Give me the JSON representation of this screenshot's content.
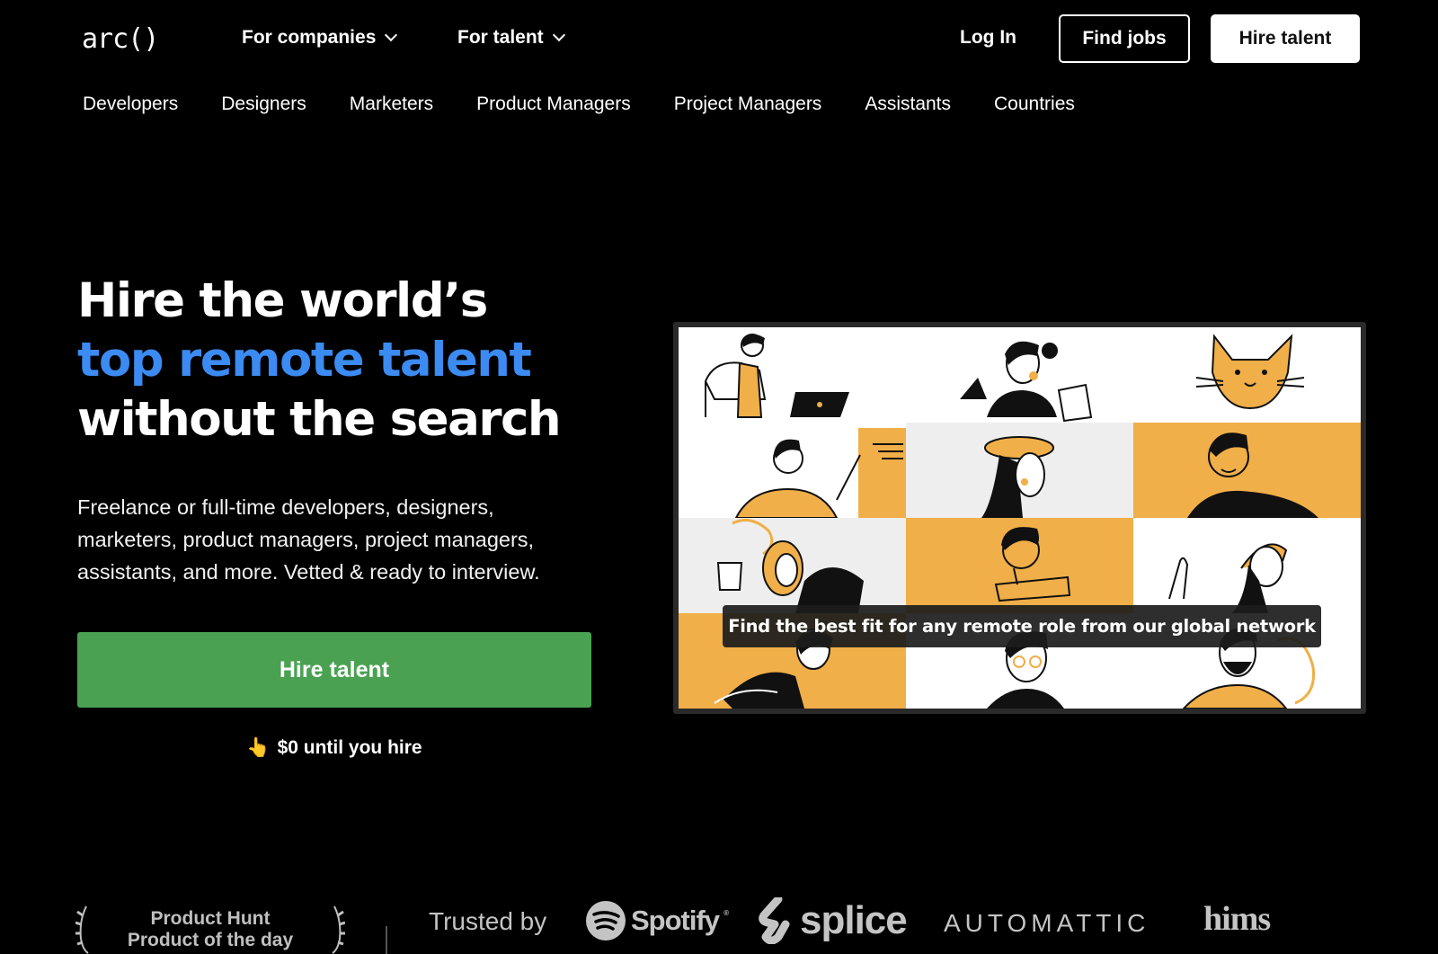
{
  "header": {
    "logo": "arc()",
    "nav": [
      {
        "label": "For companies"
      },
      {
        "label": "For talent"
      }
    ],
    "login": "Log In",
    "find_jobs": "Find jobs",
    "hire_talent": "Hire talent"
  },
  "subnav": [
    "Developers",
    "Designers",
    "Marketers",
    "Product Managers",
    "Project Managers",
    "Assistants",
    "Countries"
  ],
  "hero": {
    "title_line1": "Hire the world’s",
    "title_line2": "top remote talent",
    "title_line3": "without the search",
    "subtitle": "Freelance or full-time developers, designers, marketers, product managers, project managers, assistants, and more. Vetted & ready to interview.",
    "cta": "Hire talent",
    "hand": "👆",
    "note": "$0 until you hire"
  },
  "video": {
    "caption": "Find the best fit for any remote role from our global network",
    "cells": [
      "white",
      "white",
      "white",
      "white",
      "gray",
      "orange",
      "gray",
      "orange",
      "white",
      "orange",
      "white",
      "white"
    ]
  },
  "badge": {
    "line1": "Product Hunt",
    "line2": "Product of the day"
  },
  "trusted": {
    "label": "Trusted by",
    "logos": {
      "spotify": "Spotify",
      "splice": "splice",
      "automattic": "AUTOMATTIC",
      "hims": "hims"
    }
  },
  "colors": {
    "accent_blue": "#3b8bf2",
    "cta_green": "#4aa152",
    "illustration_orange": "#f0af48"
  }
}
